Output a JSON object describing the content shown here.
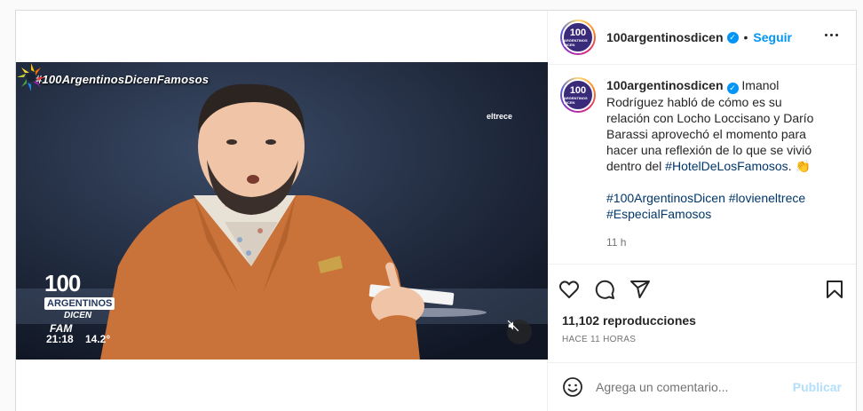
{
  "post": {
    "username": "100argentinosdicen",
    "follow_label": "Seguir",
    "dot": "•",
    "verified_icon": "verified-badge-icon",
    "avatar": {
      "number": "100",
      "text": "ARGENTINOS DICEN"
    },
    "caption_text": "Imanol Rodríguez habló de cómo es su relación con Locho Loccisano y Darío Barassi aprovechó el momento para hacer una reflexión de lo que se vivió dentro del ",
    "caption_tag": "#HotelDeLosFamosos",
    "caption_emoji": "👏",
    "hashtags": [
      "#100ArgentinosDicen",
      "#lovieneltrece",
      "#EspecialFamosos"
    ],
    "time": "11 h",
    "views": "11,102 reproducciones",
    "ago": "HACE 11 HORAS"
  },
  "video": {
    "overlay_hashtag": "#100ArgentinosDicenFamosos",
    "channel": "eltrece",
    "show_logo": {
      "number": "100",
      "word": "ARGENTINOS",
      "dicen": "DICEN",
      "fam": "FAM"
    },
    "clock": "21:18",
    "temperature": "14.2°"
  },
  "comment": {
    "placeholder": "Agrega un comentario...",
    "publish_label": "Publicar"
  },
  "colors": {
    "link": "#0095f6",
    "hashtag": "#00376b",
    "jacket": "#c9733a"
  }
}
